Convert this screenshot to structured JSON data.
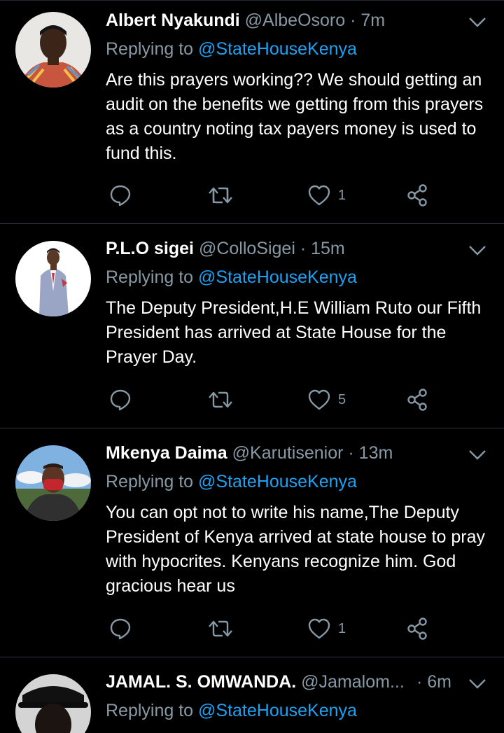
{
  "colors": {
    "background": "#000000",
    "text": "#ffffff",
    "muted": "#8899a6",
    "link": "#1da1f2",
    "divider": "#2b3640"
  },
  "icons": {
    "reply": "reply-icon",
    "retweet": "retweet-icon",
    "like": "heart-icon",
    "share": "share-icon",
    "more": "chevron-down-icon"
  },
  "tweets": [
    {
      "name": "Albert Nyakundi",
      "handle": "@AlbeOsoro",
      "dot": "·",
      "time": "7m",
      "replying_prefix": "Replying to",
      "replying_to": "@StateHouseKenya",
      "text": "Are this prayers working?? We should getting an audit on the benefits we getting from this prayers as a country noting tax payers money is used to fund this.",
      "likes": "1"
    },
    {
      "name": "P.L.O sigei",
      "handle": "@ColloSigei",
      "dot": "·",
      "time": "15m",
      "replying_prefix": "Replying to",
      "replying_to": "@StateHouseKenya",
      "text": "The Deputy President,H.E William Ruto our Fifth President has arrived at State House for the Prayer Day.",
      "likes": "5"
    },
    {
      "name": "Mkenya Daima",
      "handle": "@Karutisenior",
      "dot": "·",
      "time": "13m",
      "replying_prefix": "Replying to",
      "replying_to": "@StateHouseKenya",
      "text": "You can opt not to write his name,The Deputy President of Kenya arrived at state house to pray with hypocrites. Kenyans recognize him. God gracious hear us",
      "likes": "1"
    },
    {
      "name": "JAMAL. S. OMWANDA.",
      "handle": "@Jamalom...",
      "dot": "·",
      "time": "6m",
      "replying_prefix": "Replying to",
      "replying_to": "@StateHouseKenya"
    }
  ]
}
